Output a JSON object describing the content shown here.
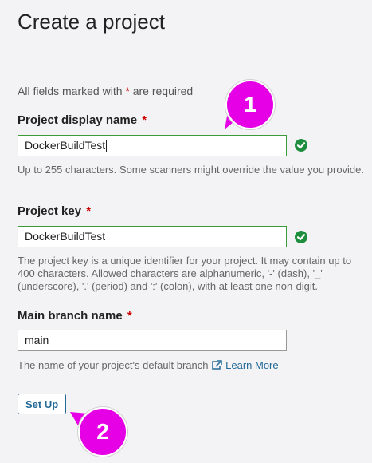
{
  "page": {
    "title": "Create a project"
  },
  "form": {
    "required_note_prefix": "All fields marked with ",
    "required_star": "*",
    "required_note_suffix": " are required",
    "display_name": {
      "label": "Project display name",
      "star": "*",
      "value": "DockerBuildTest",
      "help": "Up to 255 characters. Some scanners might override the value you provide."
    },
    "project_key": {
      "label": "Project key",
      "star": "*",
      "value": "DockerBuildTest",
      "help": "The project key is a unique identifier for your project. It may contain up to 400 characters. Allowed characters are alphanumeric, '-' (dash), '_' (underscore), '.' (period) and ':' (colon), with at least one non-digit."
    },
    "main_branch": {
      "label": "Main branch name",
      "star": "*",
      "value": "main",
      "help": "The name of your project's default branch",
      "learn_more": "Learn More"
    },
    "setup_button": "Set Up"
  },
  "annotations": {
    "callout_1": "1",
    "callout_2": "2",
    "color": "#e600e6"
  },
  "colors": {
    "valid_border": "#3a9b3a",
    "check": "#1e8e3e",
    "link": "#236a97",
    "required": "#cc0000"
  }
}
